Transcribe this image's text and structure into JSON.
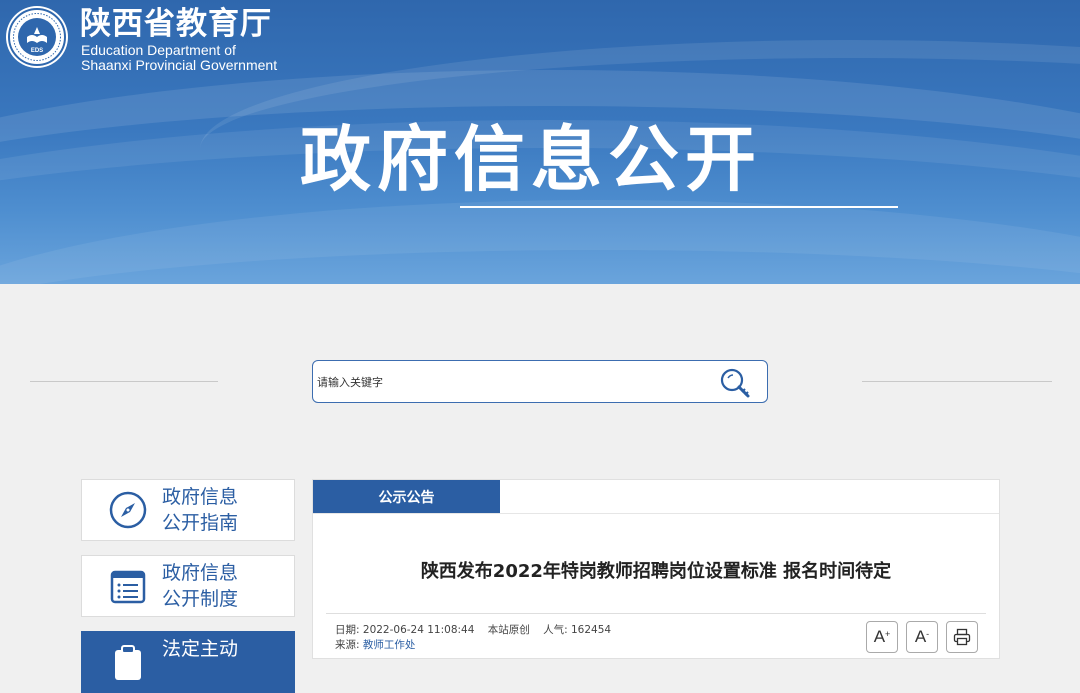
{
  "header": {
    "site_name_cn": "陕西省教育厅",
    "site_name_en_line1": "Education Department of",
    "site_name_en_line2": "Shaanxi Provincial Government",
    "logo_text": "EDS",
    "hero_title": "政府信息公开"
  },
  "search": {
    "placeholder": "请输入关键字"
  },
  "sidebar": {
    "items": [
      {
        "line1": "政府信息",
        "line2": "公开指南",
        "icon": "compass-icon"
      },
      {
        "line1": "政府信息",
        "line2": "公开制度",
        "icon": "document-list-icon"
      },
      {
        "line1": "法定主动",
        "line2": "",
        "icon": "clipboard-icon"
      }
    ]
  },
  "panel": {
    "tab_label": "公示公告",
    "article_title": "陕西发布2022年特岗教师招聘岗位设置标准 报名时间待定",
    "meta": {
      "date_label": "日期:",
      "date_value": "2022-06-24 11:08:44",
      "original_label": "本站原创",
      "views_label": "人气:",
      "views_value": "162454",
      "source_label": "来源:",
      "source_value": "教师工作处"
    },
    "tools": {
      "font_increase": "A",
      "font_increase_sup": "+",
      "font_decrease": "A",
      "font_decrease_sup": "-"
    }
  },
  "colors": {
    "brand_blue": "#2b5ea3",
    "banner_top": "#2f67ad",
    "page_bg": "#f0f0f0"
  }
}
